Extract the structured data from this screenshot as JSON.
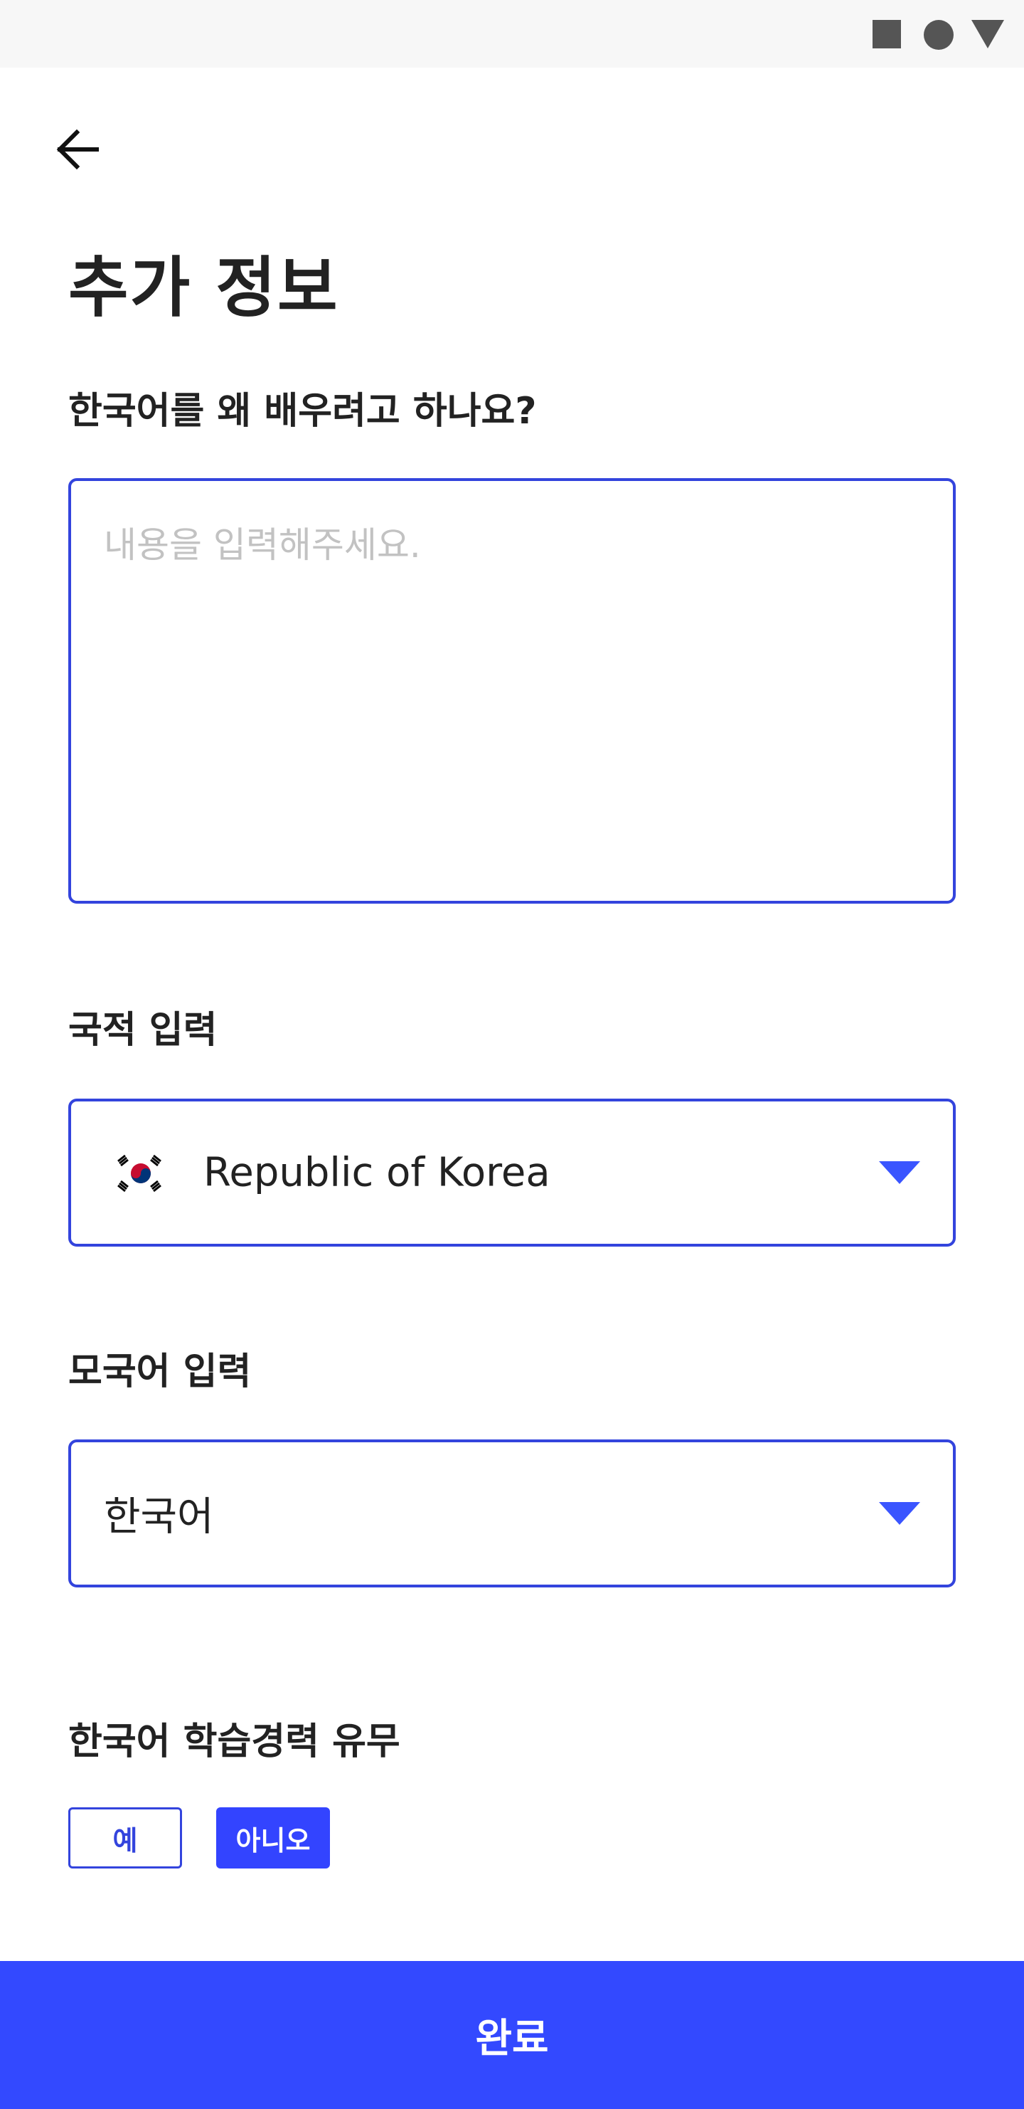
{
  "header": {
    "title": "추가 정보"
  },
  "reason": {
    "label": "한국어를 왜 배우려고 하나요?",
    "placeholder": "내용을 입력해주세요.",
    "value": ""
  },
  "nationality": {
    "label": "국적 입력",
    "selected": "Republic of Korea",
    "flag_icon": "south-korea-flag-icon"
  },
  "native_language": {
    "label": "모국어 입력",
    "selected": "한국어"
  },
  "experience": {
    "label": "한국어 학습경력 유무",
    "yes_label": "예",
    "no_label": "아니오",
    "selected": "아니오"
  },
  "footer": {
    "submit_label": "완료"
  },
  "colors": {
    "accent": "#3349ff",
    "border": "#3344dd",
    "placeholder": "#c2c2c2"
  }
}
